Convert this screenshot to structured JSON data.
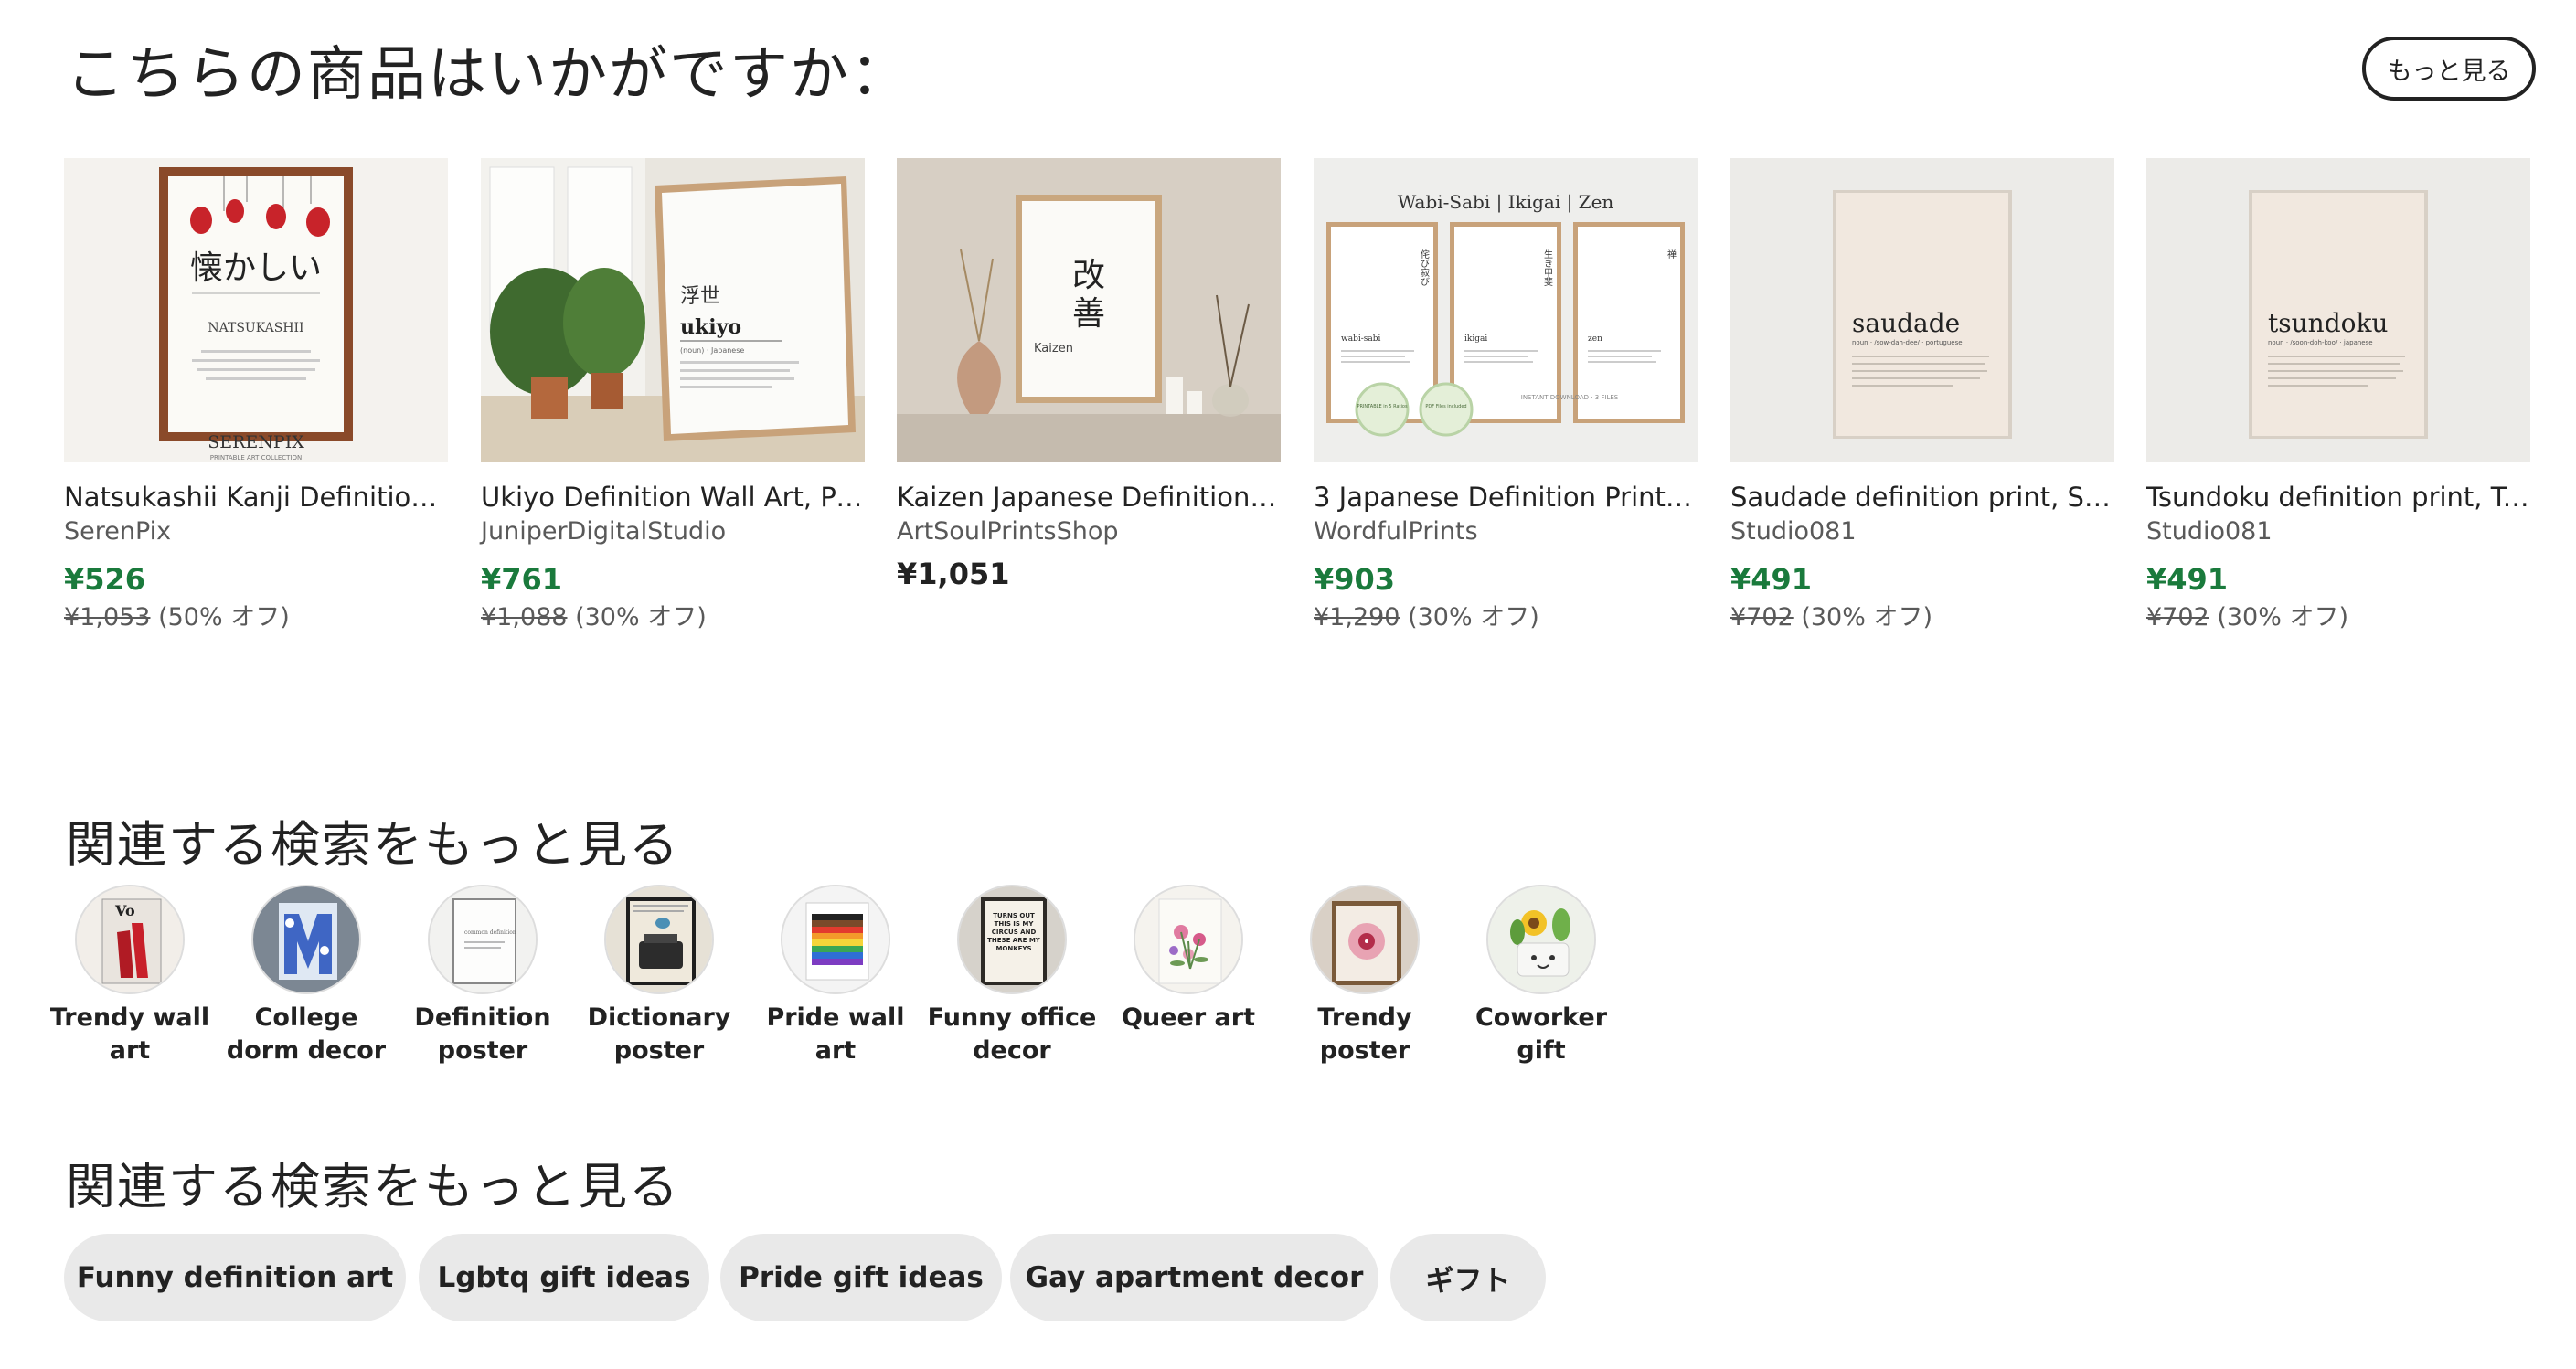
{
  "recommendations": {
    "title": "こちらの商品はいかがですか：",
    "more_label": "もっと見る",
    "products": [
      {
        "title": "Natsukashii Kanji Definition ...",
        "shop": "SerenPix",
        "price": "¥526",
        "original": "¥1,053",
        "discount": "(50% オフ)",
        "on_sale": true,
        "art": {
          "kanji": "懐かしい",
          "word": "NATSUKASHII",
          "brand": "SERENPIX",
          "brand_sub": "PRINTABLE ART COLLECTION"
        }
      },
      {
        "title": "Ukiyo Definition Wall Art, Pri...",
        "shop": "JuniperDigitalStudio",
        "price": "¥761",
        "original": "¥1,088",
        "discount": "(30% オフ)",
        "on_sale": true,
        "art": {
          "kanji": "浮世",
          "word": "ukiyo",
          "sub": "(noun) · Japanese"
        }
      },
      {
        "title": "Kaizen Japanese Definition P...",
        "shop": "ArtSoulPrintsShop",
        "price": "¥1,051",
        "original": "",
        "discount": "",
        "on_sale": false,
        "art": {
          "kanji1": "改",
          "kanji2": "善",
          "word": "Kaizen"
        }
      },
      {
        "title": "3 Japanese Definition Print B...",
        "shop": "WordfulPrints",
        "price": "¥903",
        "original": "¥1,290",
        "discount": "(30% オフ)",
        "on_sale": true,
        "art": {
          "header": "Wabi-Sabi | Ikigai | Zen",
          "w1": "wabi-sabi",
          "w2": "ikigai",
          "w3": "zen",
          "k1": "侘び寂び",
          "k2": "生き甲斐",
          "k3": "禅",
          "badge1": "PRINTABLE in 5 Ratios",
          "badge2": "PDF Files included",
          "footer": "INSTANT DOWNLOAD · 3 FILES"
        }
      },
      {
        "title": "Saudade definition print, Sa...",
        "shop": "Studio081",
        "price": "¥491",
        "original": "¥702",
        "discount": "(30% オフ)",
        "on_sale": true,
        "art": {
          "word": "saudade",
          "pron": "noun · /sow-dah-dee/ · portuguese"
        }
      },
      {
        "title": "Tsundoku definition print, Ts...",
        "shop": "Studio081",
        "price": "¥491",
        "original": "¥702",
        "discount": "(30% オフ)",
        "on_sale": true,
        "art": {
          "word": "tsundoku",
          "pron": "noun · /soon-doh-koo/ · japanese"
        }
      }
    ]
  },
  "related_circles": {
    "title": "関連する検索をもっと見る",
    "items": [
      {
        "line1": "Trendy wall",
        "line2": "art"
      },
      {
        "line1": "College",
        "line2": "dorm decor"
      },
      {
        "line1": "Definition",
        "line2": "poster"
      },
      {
        "line1": "Dictionary",
        "line2": "poster"
      },
      {
        "line1": "Pride wall art",
        "line2": ""
      },
      {
        "line1": "Funny office",
        "line2": "decor"
      },
      {
        "line1": "Queer art",
        "line2": ""
      },
      {
        "line1": "Trendy",
        "line2": "poster"
      },
      {
        "line1": "Coworker",
        "line2": "gift"
      }
    ],
    "thumb_text": {
      "funny": "TURNS OUT THIS IS MY CIRCUS AND THESE ARE MY MONKEYS",
      "definition": "common definition"
    }
  },
  "related_pills": {
    "title": "関連する検索をもっと見る",
    "items": [
      "Funny definition art",
      "Lgbtq gift ideas",
      "Pride gift ideas",
      "Gay apartment decor",
      "ギフト"
    ]
  },
  "colors": {
    "sale": "#1a7a3c",
    "pill_bg": "#e9e9e9",
    "text": "#222222",
    "muted": "#595959"
  }
}
